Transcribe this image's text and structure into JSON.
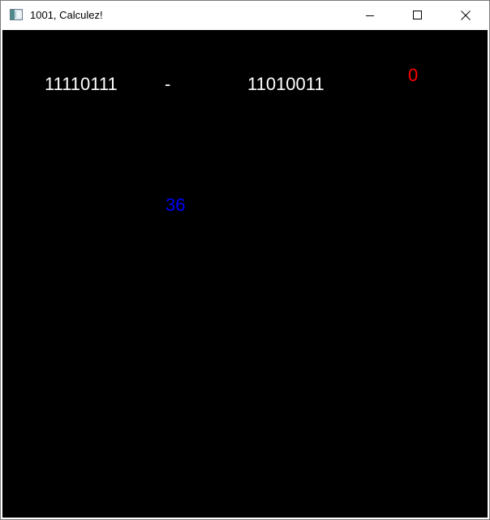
{
  "window": {
    "title": "1001, Calculez!",
    "icon": "app-window-icon",
    "controls": [
      "minimize-icon",
      "maximize-icon",
      "close-icon"
    ]
  },
  "game": {
    "operand_a": "11110111",
    "operator": "-",
    "operand_b": "11010011",
    "score": "0",
    "answer": "36"
  },
  "colors": {
    "background": "#000000",
    "problem_text": "#ffffff",
    "score_text": "#ff0000",
    "answer_text": "#0000ff"
  }
}
